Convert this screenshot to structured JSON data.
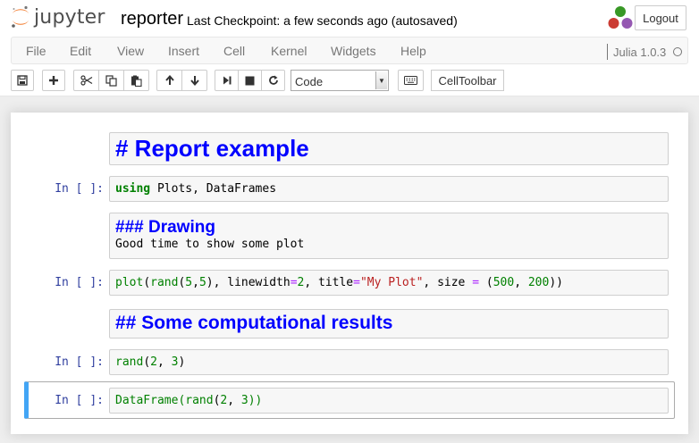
{
  "header": {
    "logo_text": "jupyter",
    "notebook_name": "reporter",
    "checkpoint": "Last Checkpoint: a few seconds ago (autosaved)",
    "logout_label": "Logout"
  },
  "menu": {
    "items": [
      "File",
      "Edit",
      "View",
      "Insert",
      "Cell",
      "Kernel",
      "Widgets",
      "Help"
    ],
    "kernel_name": "Julia 1.0.3"
  },
  "toolbar": {
    "buttons": [
      "save-icon",
      "plus-icon",
      "cut-icon",
      "copy-icon",
      "paste-icon",
      "arrow-up-icon",
      "arrow-down-icon",
      "step-forward-icon",
      "stop-icon",
      "refresh-icon",
      "keyboard-icon"
    ],
    "cell_type": "Code",
    "celltoolbar_label": "CellToolbar"
  },
  "cells": {
    "c1": {
      "type": "markdown",
      "text": "# Report example"
    },
    "c2": {
      "prompt": "In [ ]:",
      "kw": "using",
      "rest": " Plots, DataFrames"
    },
    "c3": {
      "type": "markdown",
      "heading": "### Drawing",
      "body": "Good time to show some plot"
    },
    "c4": {
      "prompt": "In [ ]:",
      "tokens": [
        "plot",
        "(",
        "rand",
        "(",
        "5",
        ",",
        "5",
        "), linewidth",
        "=",
        "2",
        ", title",
        "=",
        "\"My Plot\"",
        ", size ",
        "=",
        " (",
        "500",
        ", ",
        "200",
        "))"
      ]
    },
    "c5": {
      "type": "markdown",
      "text": "## Some computational results"
    },
    "c6": {
      "prompt": "In [ ]:",
      "tokens": [
        "rand",
        "(",
        "2",
        ", ",
        "3",
        ")"
      ]
    },
    "c7": {
      "prompt": "In [ ]:",
      "tokens": [
        "DataFrame",
        "(",
        "rand",
        "(",
        "2",
        ", ",
        "3",
        "))"
      ]
    }
  },
  "colors": {
    "accent_selected": "#42a5f5",
    "prompt": "#303f9f",
    "markdown_heading": "#0000ff",
    "builtin": "#008000",
    "string": "#ba2121",
    "operator": "#aa22ff"
  }
}
